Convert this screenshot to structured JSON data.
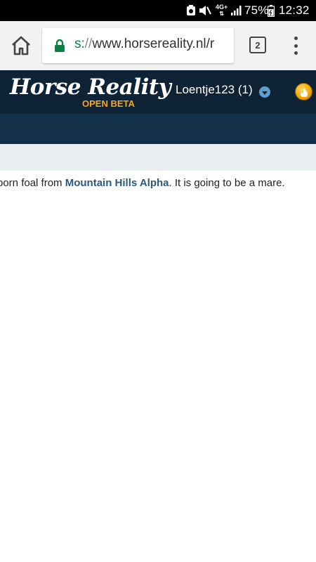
{
  "status_bar": {
    "battery_percent": "75%",
    "time": "12:32",
    "network": "4G+",
    "icons": [
      "notification-icon",
      "mute-icon",
      "network-4g-icon",
      "signal-icon",
      "battery-icon"
    ]
  },
  "browser": {
    "url_scheme": "s:",
    "url_sep": "//",
    "url_host": "www.horsereality.nl/r",
    "tab_count": "2",
    "icons": [
      "home-icon",
      "lock-icon",
      "more-vertical-icon"
    ]
  },
  "site": {
    "logo_text": "Horse Reality",
    "logo_badge": "OPEN BETA",
    "username": "Loentje123 (1)",
    "icons": [
      "dropdown-icon",
      "coin-icon"
    ]
  },
  "message": {
    "prefix": "born foal from ",
    "link_text": "Mountain Hills Alpha",
    "suffix": ". It is going to be a mare."
  },
  "colors": {
    "header_bg": "#0f2336",
    "subnav_bg": "#123048",
    "badge": "#f5a623",
    "link": "#2c5a7a",
    "url_scheme": "#0b8043"
  }
}
